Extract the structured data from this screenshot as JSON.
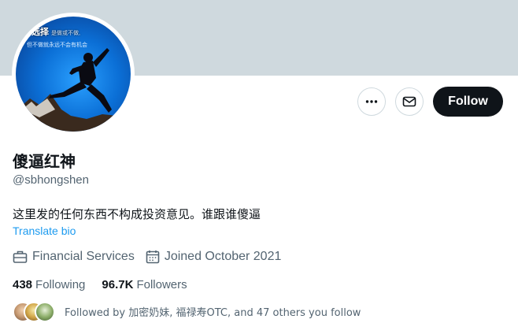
{
  "profile": {
    "display_name": "傻逼红神",
    "handle": "@sbhongshen",
    "bio": "这里发的任何东西不构成投资意见。谁跟谁傻逼",
    "translate_label": "Translate bio",
    "avatar_text_line1": "选择",
    "avatar_text_line1_small": "是做或不做,",
    "avatar_text_line2": "但不做就永远不会有机会"
  },
  "actions": {
    "more_icon": "more-dots-icon",
    "message_icon": "envelope-icon",
    "follow_label": "Follow"
  },
  "meta": {
    "category_icon": "briefcase-icon",
    "category": "Financial Services",
    "joined_icon": "calendar-icon",
    "joined": "Joined October 2021"
  },
  "stats": {
    "following_count": "438",
    "following_label": "Following",
    "followers_count": "96.7K",
    "followers_label": "Followers"
  },
  "followed_by": {
    "text": "Followed by 加密奶妹, 福禄寿OTC, and 47 others you follow"
  },
  "colors": {
    "banner": "#cfd9de",
    "follow_button": "#0f1419",
    "link": "#1d9bf0",
    "secondary_text": "#536471"
  }
}
